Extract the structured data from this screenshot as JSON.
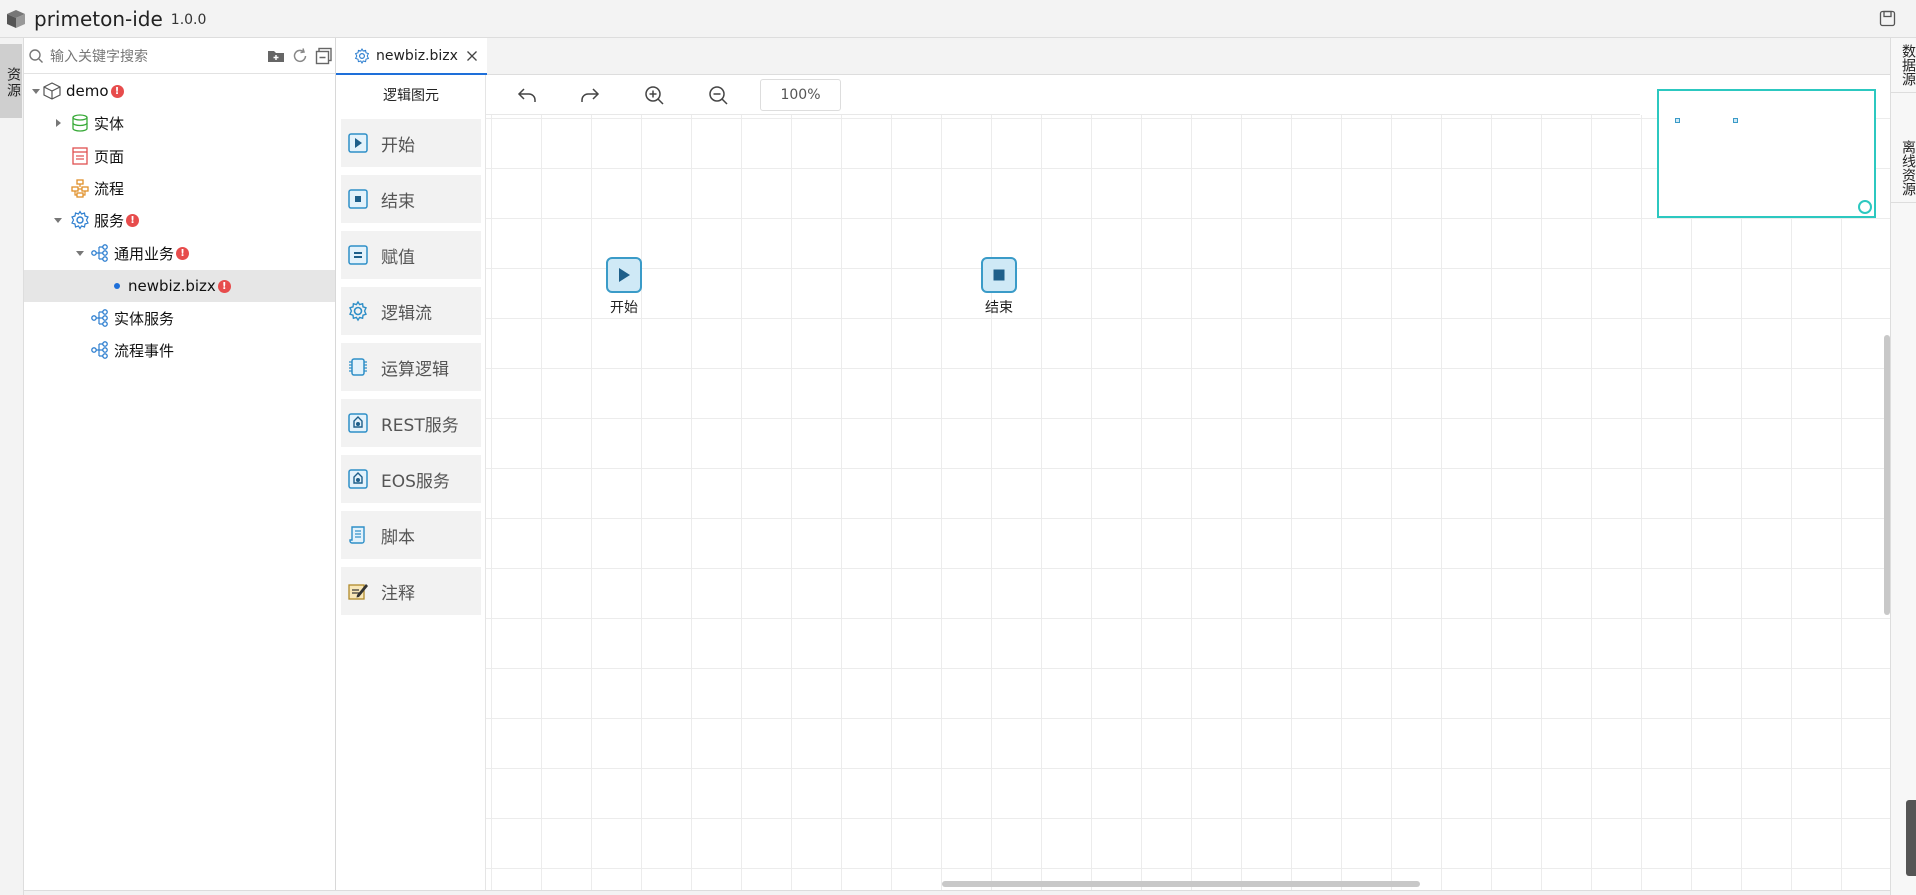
{
  "app": {
    "name": "primeton-ide",
    "version": "1.0.0"
  },
  "left_strip": {
    "tab_label": "资源"
  },
  "tree": {
    "search_placeholder": "输入关键字搜索",
    "items": [
      {
        "label": "demo",
        "badge": "!"
      },
      {
        "label": "实体"
      },
      {
        "label": "页面"
      },
      {
        "label": "流程"
      },
      {
        "label": "服务",
        "badge": "!"
      },
      {
        "label": "通用业务",
        "badge": "!"
      },
      {
        "label": "newbiz.bizx",
        "badge": "!"
      },
      {
        "label": "实体服务"
      },
      {
        "label": "流程事件"
      }
    ]
  },
  "editor": {
    "tab_label": "newbiz.bizx",
    "zoom": "100%"
  },
  "palette": {
    "title": "逻辑图元",
    "items": [
      {
        "label": "开始",
        "icon": "play-icon"
      },
      {
        "label": "结束",
        "icon": "stop-icon"
      },
      {
        "label": "赋值",
        "icon": "assign-icon"
      },
      {
        "label": "逻辑流",
        "icon": "gear-icon"
      },
      {
        "label": "运算逻辑",
        "icon": "chip-icon"
      },
      {
        "label": "REST服务",
        "icon": "rest-icon"
      },
      {
        "label": "EOS服务",
        "icon": "eos-icon"
      },
      {
        "label": "脚本",
        "icon": "script-icon"
      },
      {
        "label": "注释",
        "icon": "note-icon"
      }
    ]
  },
  "canvas": {
    "nodes": [
      {
        "label": "开始",
        "type": "start"
      },
      {
        "label": "结束",
        "type": "end"
      }
    ]
  },
  "right_strip": {
    "tabs": [
      "数据源",
      "离线资源"
    ]
  },
  "colors": {
    "accent": "#1e6fd9",
    "node_border": "#3a9bc8",
    "minimap_border": "#2cc8c0",
    "badge": "#e74c4c"
  }
}
